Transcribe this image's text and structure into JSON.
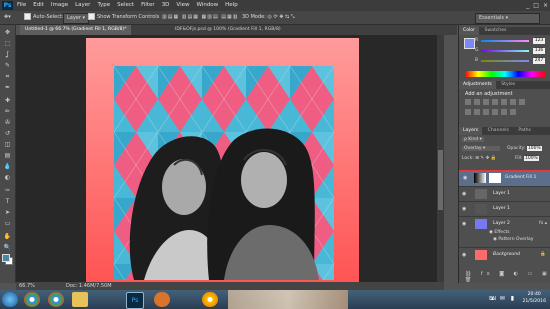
{
  "menubar": {
    "logo": "Ps",
    "items": [
      "File",
      "Edit",
      "Image",
      "Layer",
      "Type",
      "Select",
      "Filter",
      "3D",
      "View",
      "Window",
      "Help"
    ],
    "window_controls": [
      "_",
      "□",
      "×"
    ]
  },
  "options_bar": {
    "auto_select_label": "Auto-Select:",
    "auto_select_value": "Layer",
    "show_transform_label": "Show Transform Controls",
    "workspace": "Essentials"
  },
  "doc_tabs": [
    {
      "label": "Untitled-1 @ 66.7% (Gradient Fill 1, RGB/8)*",
      "active": true
    },
    {
      "label": "IDF&OFjs.psd @ 100% (Gradient Fill 1, RGB/8)",
      "active": false
    }
  ],
  "toolbar": {
    "icons": [
      "move-icon",
      "marquee-icon",
      "lasso-icon",
      "quick-select-icon",
      "crop-icon",
      "eyedropper-icon",
      "healing-icon",
      "brush-icon",
      "clone-stamp-icon",
      "history-brush-icon",
      "eraser-icon",
      "gradient-icon",
      "blur-icon",
      "dodge-icon",
      "pen-icon",
      "type-icon",
      "path-select-icon",
      "shape-icon",
      "hand-icon",
      "zoom-icon"
    ],
    "glyphs": [
      "✥",
      "⬚",
      "ʆ",
      "✎",
      "⌗",
      "✒",
      "✚",
      "✏",
      "✇",
      "↺",
      "◫",
      "▤",
      "💧",
      "◐",
      "✑",
      "T",
      "➤",
      "▭",
      "✋",
      "🔍"
    ],
    "foreground_color": "#4b86a4",
    "background_color": "#ffffff"
  },
  "status": {
    "zoom": "66.7%",
    "doc": "Doc: 1.46M/7.50M"
  },
  "color_panel": {
    "tabs": [
      "Color",
      "Swatches"
    ],
    "r": "123",
    "g": "136",
    "b": "247",
    "swatch": "#7b88f7"
  },
  "adjustments_panel": {
    "tabs": [
      "Adjustments",
      "Styles"
    ],
    "title": "Add an adjustment"
  },
  "layers_panel": {
    "tabs": [
      "Layers",
      "Channels",
      "Paths"
    ],
    "kind": "Kind",
    "blend_mode": "Overlay",
    "opacity_label": "Opacity:",
    "opacity": "100%",
    "lock_label": "Lock:",
    "fill_label": "Fill:",
    "fill": "100%",
    "layers": [
      {
        "name": "Gradient Fill 1",
        "selected": true,
        "thumb": "#222"
      },
      {
        "name": "Layer 1",
        "selected": false,
        "thumb": "#666"
      },
      {
        "name": "Layer 1",
        "selected": false,
        "thumb": "#555"
      },
      {
        "name": "Layer 2",
        "selected": false,
        "thumb": "#7878f0"
      },
      {
        "name": "Effects",
        "sub": true
      },
      {
        "name": "Pattern Overlay",
        "sub": true
      },
      {
        "name": "Background",
        "selected": false,
        "thumb": "#ff6a6a"
      }
    ]
  },
  "taskbar": {
    "apps": [
      "start-icon",
      "chrome-icon",
      "chrome-icon",
      "folder-icon",
      "photoshop-icon",
      "media-icon",
      "chrome-canary-icon"
    ],
    "lang": "EN",
    "time": "20:40",
    "date": "21/5/2016"
  }
}
